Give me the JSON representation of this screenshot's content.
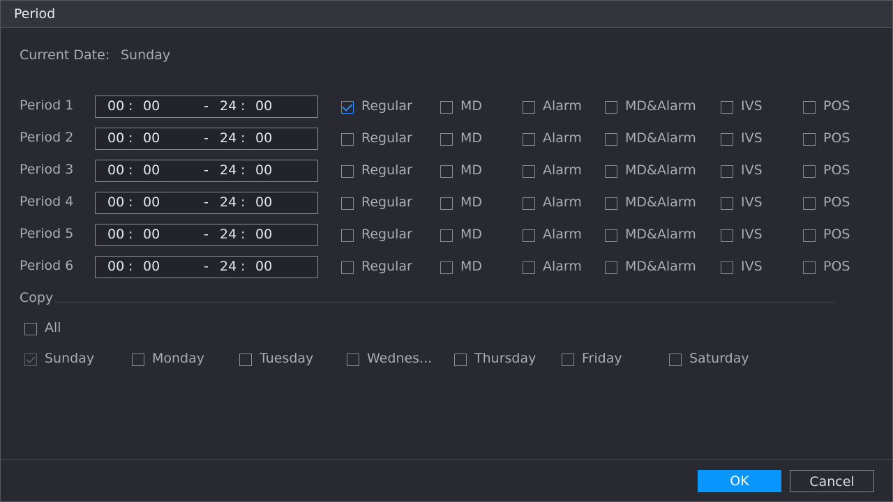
{
  "dialog": {
    "title": "Period"
  },
  "current_date": {
    "label": "Current Date:",
    "value": "Sunday"
  },
  "periods": [
    {
      "label": "Period 1",
      "start_h": "00",
      "start_m": "00",
      "end_h": "24",
      "end_m": "00"
    },
    {
      "label": "Period 2",
      "start_h": "00",
      "start_m": "00",
      "end_h": "24",
      "end_m": "00"
    },
    {
      "label": "Period 3",
      "start_h": "00",
      "start_m": "00",
      "end_h": "24",
      "end_m": "00"
    },
    {
      "label": "Period 4",
      "start_h": "00",
      "start_m": "00",
      "end_h": "24",
      "end_m": "00"
    },
    {
      "label": "Period 5",
      "start_h": "00",
      "start_m": "00",
      "end_h": "24",
      "end_m": "00"
    },
    {
      "label": "Period 6",
      "start_h": "00",
      "start_m": "00",
      "end_h": "24",
      "end_m": "00"
    }
  ],
  "time_separators": {
    "colon": ":",
    "dash": "-"
  },
  "record_types": [
    "Regular",
    "MD",
    "Alarm",
    "MD&Alarm",
    "IVS",
    "POS"
  ],
  "period_checked": [
    [
      true,
      false,
      false,
      false,
      false,
      false
    ],
    [
      false,
      false,
      false,
      false,
      false,
      false
    ],
    [
      false,
      false,
      false,
      false,
      false,
      false
    ],
    [
      false,
      false,
      false,
      false,
      false,
      false
    ],
    [
      false,
      false,
      false,
      false,
      false,
      false
    ],
    [
      false,
      false,
      false,
      false,
      false,
      false
    ]
  ],
  "copy": {
    "label": "Copy",
    "all_label": "All",
    "all_checked": false,
    "days": [
      {
        "label": "Sunday",
        "checked": true,
        "disabled": true
      },
      {
        "label": "Monday",
        "checked": false
      },
      {
        "label": "Tuesday",
        "checked": false
      },
      {
        "label": "Wednes...",
        "checked": false
      },
      {
        "label": "Thursday",
        "checked": false
      },
      {
        "label": "Friday",
        "checked": false
      },
      {
        "label": "Saturday",
        "checked": false
      }
    ]
  },
  "buttons": {
    "ok": "OK",
    "cancel": "Cancel"
  },
  "colors": {
    "accent": "#0a96ff",
    "check": "#2e8bff",
    "background": "#292a31"
  }
}
